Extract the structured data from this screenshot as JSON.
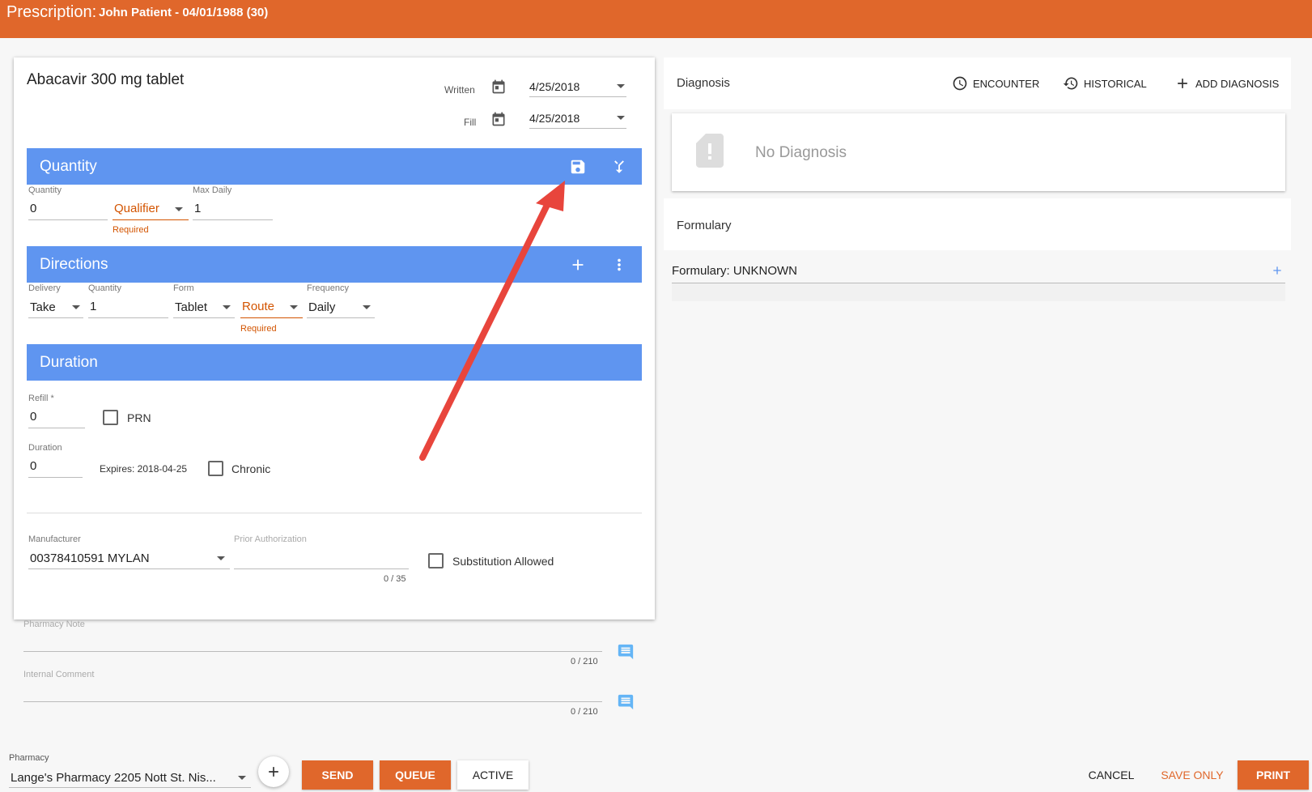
{
  "header": {
    "title": "Prescription:",
    "patient": "John Patient - 04/01/1988 (30)"
  },
  "drug": {
    "name": "Abacavir 300 mg tablet",
    "written_label": "Written",
    "written_date": "4/25/2018",
    "fill_label": "Fill",
    "fill_date": "4/25/2018"
  },
  "quantity_section": {
    "title": "Quantity",
    "quantity_label": "Quantity",
    "quantity_value": "0",
    "qualifier_placeholder": "Qualifier",
    "qualifier_required": "Required",
    "max_daily_label": "Max Daily",
    "max_daily_value": "1"
  },
  "directions_section": {
    "title": "Directions",
    "delivery_label": "Delivery",
    "delivery_value": "Take",
    "quantity_label": "Quantity",
    "quantity_value": "1",
    "form_label": "Form",
    "form_value": "Tablet",
    "route_placeholder": "Route",
    "route_required": "Required",
    "frequency_label": "Frequency",
    "frequency_value": "Daily"
  },
  "duration_section": {
    "title": "Duration",
    "refill_label": "Refill *",
    "refill_value": "0",
    "prn_label": "PRN",
    "duration_label": "Duration",
    "duration_value": "0",
    "expires": "Expires: 2018-04-25",
    "chronic_label": "Chronic"
  },
  "manufacturer": {
    "label": "Manufacturer",
    "value": "00378410591 MYLAN",
    "prior_auth_label": "Prior Authorization",
    "prior_auth_counter": "0 / 35",
    "substitution_label": "Substitution Allowed"
  },
  "notes": {
    "pharmacy_note_label": "Pharmacy Note",
    "pharmacy_note_counter": "0 / 210",
    "internal_comment_label": "Internal Comment",
    "internal_comment_counter": "0 / 210"
  },
  "diagnosis": {
    "title": "Diagnosis",
    "encounter": "ENCOUNTER",
    "historical": "HISTORICAL",
    "add_diagnosis": "ADD DIAGNOSIS",
    "empty": "No Diagnosis"
  },
  "formulary": {
    "title": "Formulary",
    "status": "Formulary: UNKNOWN"
  },
  "footer": {
    "pharmacy_label": "Pharmacy",
    "pharmacy_value": "Lange's Pharmacy 2205 Nott St. Nis...",
    "send": "SEND",
    "queue": "QUEUE",
    "active": "ACTIVE",
    "cancel": "CANCEL",
    "save_only": "SAVE ONLY",
    "print": "PRINT"
  },
  "colors": {
    "brand_orange": "#e0672b",
    "section_blue": "#5f95f0",
    "required_red": "#d35400",
    "annotation_arrow": "#e8453c",
    "comment_icon_blue": "#64b5f6"
  }
}
